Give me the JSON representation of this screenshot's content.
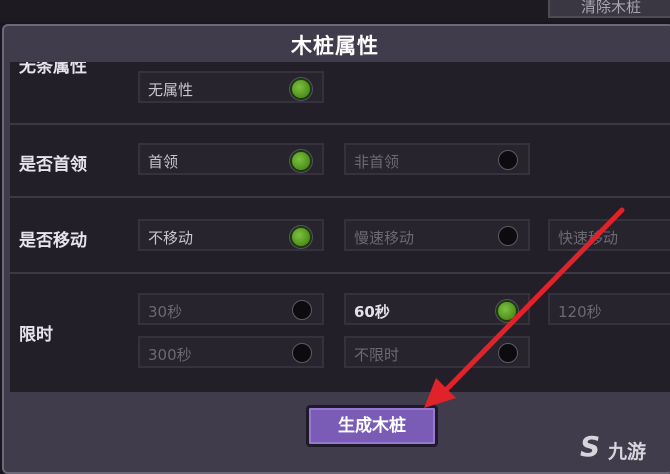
{
  "top_tab": {
    "label": "清除木桩"
  },
  "panel": {
    "title": "木桩属性"
  },
  "rows": [
    {
      "label": "无条属性",
      "options": [
        {
          "label": "无属性",
          "selected": true
        }
      ]
    },
    {
      "label": "是否首领",
      "options": [
        {
          "label": "首领",
          "selected": true
        },
        {
          "label": "非首领",
          "selected": false
        }
      ]
    },
    {
      "label": "是否移动",
      "options": [
        {
          "label": "不移动",
          "selected": true
        },
        {
          "label": "慢速移动",
          "selected": false
        },
        {
          "label": "快速移动",
          "selected": false
        }
      ]
    },
    {
      "label": "限时",
      "options": [
        {
          "label": "30秒",
          "selected": false
        },
        {
          "label": "60秒",
          "selected": true
        },
        {
          "label": "120秒",
          "selected": false
        },
        {
          "label": "300秒",
          "selected": false
        },
        {
          "label": "不限时",
          "selected": false
        }
      ]
    }
  ],
  "generate_button": {
    "label": "生成木桩"
  },
  "watermark": {
    "text": "九游",
    "mark": "S"
  },
  "colors": {
    "selected": "#5a9a26",
    "button": "#7a5cb6",
    "arrow": "#e0232a"
  }
}
